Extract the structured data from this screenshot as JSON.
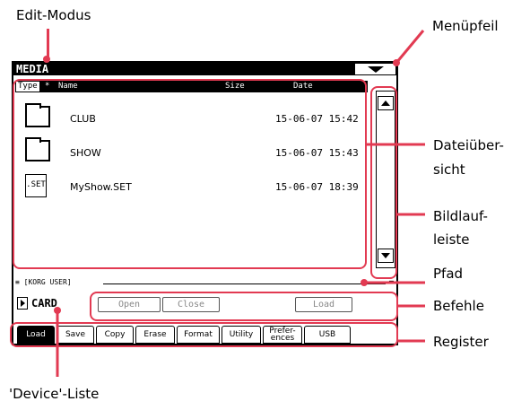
{
  "callouts": {
    "edit_mode": "Edit-Modus",
    "menu_arrow": "Menüpfeil",
    "file_view_1": "Dateiüber-",
    "file_view_2": "sicht",
    "scrollbar_1": "Bildlauf-",
    "scrollbar_2": "leiste",
    "path": "Pfad",
    "commands": "Befehle",
    "register": "Register",
    "device_list": "'Device'-Liste"
  },
  "screen": {
    "title": "MEDIA",
    "columns": {
      "type": "Type",
      "star": "*",
      "name": "Name",
      "size": "Size",
      "date": "Date"
    },
    "files": [
      {
        "icon": "folder-icon",
        "name": "CLUB",
        "date": "15-06-07 15:42"
      },
      {
        "icon": "folder-icon",
        "name": "SHOW",
        "date": "15-06-07 15:43"
      },
      {
        "icon": "set-file-icon",
        "icon_label": ".SET",
        "name": "MyShow.SET",
        "date": "15-06-07 18:39"
      }
    ],
    "path": "≡ [KORG USER]",
    "path_end": "≡",
    "device": "CARD",
    "commands": [
      "Open",
      "Close",
      "Load"
    ],
    "tabs": [
      "Load",
      "Save",
      "Copy",
      "Erase",
      "Format",
      "Utility",
      "Prefer-",
      "ences",
      "USB"
    ],
    "active_tab": "Load"
  },
  "colors": {
    "callout": "#e23a52"
  }
}
